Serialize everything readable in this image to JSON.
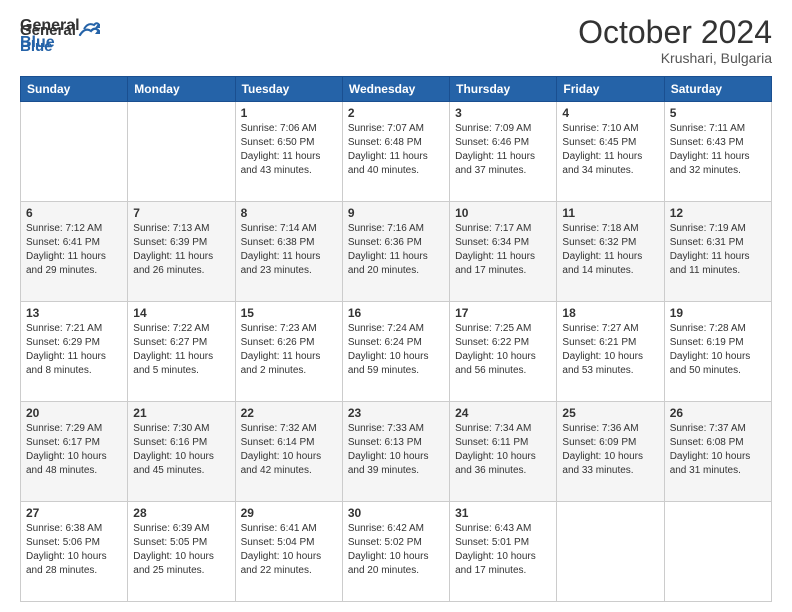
{
  "header": {
    "logo_general": "General",
    "logo_blue": "Blue",
    "month": "October 2024",
    "location": "Krushari, Bulgaria"
  },
  "weekdays": [
    "Sunday",
    "Monday",
    "Tuesday",
    "Wednesday",
    "Thursday",
    "Friday",
    "Saturday"
  ],
  "weeks": [
    [
      {
        "day": "",
        "sunrise": "",
        "sunset": "",
        "daylight": ""
      },
      {
        "day": "",
        "sunrise": "",
        "sunset": "",
        "daylight": ""
      },
      {
        "day": "1",
        "sunrise": "Sunrise: 7:06 AM",
        "sunset": "Sunset: 6:50 PM",
        "daylight": "Daylight: 11 hours and 43 minutes."
      },
      {
        "day": "2",
        "sunrise": "Sunrise: 7:07 AM",
        "sunset": "Sunset: 6:48 PM",
        "daylight": "Daylight: 11 hours and 40 minutes."
      },
      {
        "day": "3",
        "sunrise": "Sunrise: 7:09 AM",
        "sunset": "Sunset: 6:46 PM",
        "daylight": "Daylight: 11 hours and 37 minutes."
      },
      {
        "day": "4",
        "sunrise": "Sunrise: 7:10 AM",
        "sunset": "Sunset: 6:45 PM",
        "daylight": "Daylight: 11 hours and 34 minutes."
      },
      {
        "day": "5",
        "sunrise": "Sunrise: 7:11 AM",
        "sunset": "Sunset: 6:43 PM",
        "daylight": "Daylight: 11 hours and 32 minutes."
      }
    ],
    [
      {
        "day": "6",
        "sunrise": "Sunrise: 7:12 AM",
        "sunset": "Sunset: 6:41 PM",
        "daylight": "Daylight: 11 hours and 29 minutes."
      },
      {
        "day": "7",
        "sunrise": "Sunrise: 7:13 AM",
        "sunset": "Sunset: 6:39 PM",
        "daylight": "Daylight: 11 hours and 26 minutes."
      },
      {
        "day": "8",
        "sunrise": "Sunrise: 7:14 AM",
        "sunset": "Sunset: 6:38 PM",
        "daylight": "Daylight: 11 hours and 23 minutes."
      },
      {
        "day": "9",
        "sunrise": "Sunrise: 7:16 AM",
        "sunset": "Sunset: 6:36 PM",
        "daylight": "Daylight: 11 hours and 20 minutes."
      },
      {
        "day": "10",
        "sunrise": "Sunrise: 7:17 AM",
        "sunset": "Sunset: 6:34 PM",
        "daylight": "Daylight: 11 hours and 17 minutes."
      },
      {
        "day": "11",
        "sunrise": "Sunrise: 7:18 AM",
        "sunset": "Sunset: 6:32 PM",
        "daylight": "Daylight: 11 hours and 14 minutes."
      },
      {
        "day": "12",
        "sunrise": "Sunrise: 7:19 AM",
        "sunset": "Sunset: 6:31 PM",
        "daylight": "Daylight: 11 hours and 11 minutes."
      }
    ],
    [
      {
        "day": "13",
        "sunrise": "Sunrise: 7:21 AM",
        "sunset": "Sunset: 6:29 PM",
        "daylight": "Daylight: 11 hours and 8 minutes."
      },
      {
        "day": "14",
        "sunrise": "Sunrise: 7:22 AM",
        "sunset": "Sunset: 6:27 PM",
        "daylight": "Daylight: 11 hours and 5 minutes."
      },
      {
        "day": "15",
        "sunrise": "Sunrise: 7:23 AM",
        "sunset": "Sunset: 6:26 PM",
        "daylight": "Daylight: 11 hours and 2 minutes."
      },
      {
        "day": "16",
        "sunrise": "Sunrise: 7:24 AM",
        "sunset": "Sunset: 6:24 PM",
        "daylight": "Daylight: 10 hours and 59 minutes."
      },
      {
        "day": "17",
        "sunrise": "Sunrise: 7:25 AM",
        "sunset": "Sunset: 6:22 PM",
        "daylight": "Daylight: 10 hours and 56 minutes."
      },
      {
        "day": "18",
        "sunrise": "Sunrise: 7:27 AM",
        "sunset": "Sunset: 6:21 PM",
        "daylight": "Daylight: 10 hours and 53 minutes."
      },
      {
        "day": "19",
        "sunrise": "Sunrise: 7:28 AM",
        "sunset": "Sunset: 6:19 PM",
        "daylight": "Daylight: 10 hours and 50 minutes."
      }
    ],
    [
      {
        "day": "20",
        "sunrise": "Sunrise: 7:29 AM",
        "sunset": "Sunset: 6:17 PM",
        "daylight": "Daylight: 10 hours and 48 minutes."
      },
      {
        "day": "21",
        "sunrise": "Sunrise: 7:30 AM",
        "sunset": "Sunset: 6:16 PM",
        "daylight": "Daylight: 10 hours and 45 minutes."
      },
      {
        "day": "22",
        "sunrise": "Sunrise: 7:32 AM",
        "sunset": "Sunset: 6:14 PM",
        "daylight": "Daylight: 10 hours and 42 minutes."
      },
      {
        "day": "23",
        "sunrise": "Sunrise: 7:33 AM",
        "sunset": "Sunset: 6:13 PM",
        "daylight": "Daylight: 10 hours and 39 minutes."
      },
      {
        "day": "24",
        "sunrise": "Sunrise: 7:34 AM",
        "sunset": "Sunset: 6:11 PM",
        "daylight": "Daylight: 10 hours and 36 minutes."
      },
      {
        "day": "25",
        "sunrise": "Sunrise: 7:36 AM",
        "sunset": "Sunset: 6:09 PM",
        "daylight": "Daylight: 10 hours and 33 minutes."
      },
      {
        "day": "26",
        "sunrise": "Sunrise: 7:37 AM",
        "sunset": "Sunset: 6:08 PM",
        "daylight": "Daylight: 10 hours and 31 minutes."
      }
    ],
    [
      {
        "day": "27",
        "sunrise": "Sunrise: 6:38 AM",
        "sunset": "Sunset: 5:06 PM",
        "daylight": "Daylight: 10 hours and 28 minutes."
      },
      {
        "day": "28",
        "sunrise": "Sunrise: 6:39 AM",
        "sunset": "Sunset: 5:05 PM",
        "daylight": "Daylight: 10 hours and 25 minutes."
      },
      {
        "day": "29",
        "sunrise": "Sunrise: 6:41 AM",
        "sunset": "Sunset: 5:04 PM",
        "daylight": "Daylight: 10 hours and 22 minutes."
      },
      {
        "day": "30",
        "sunrise": "Sunrise: 6:42 AM",
        "sunset": "Sunset: 5:02 PM",
        "daylight": "Daylight: 10 hours and 20 minutes."
      },
      {
        "day": "31",
        "sunrise": "Sunrise: 6:43 AM",
        "sunset": "Sunset: 5:01 PM",
        "daylight": "Daylight: 10 hours and 17 minutes."
      },
      {
        "day": "",
        "sunrise": "",
        "sunset": "",
        "daylight": ""
      },
      {
        "day": "",
        "sunrise": "",
        "sunset": "",
        "daylight": ""
      }
    ]
  ]
}
